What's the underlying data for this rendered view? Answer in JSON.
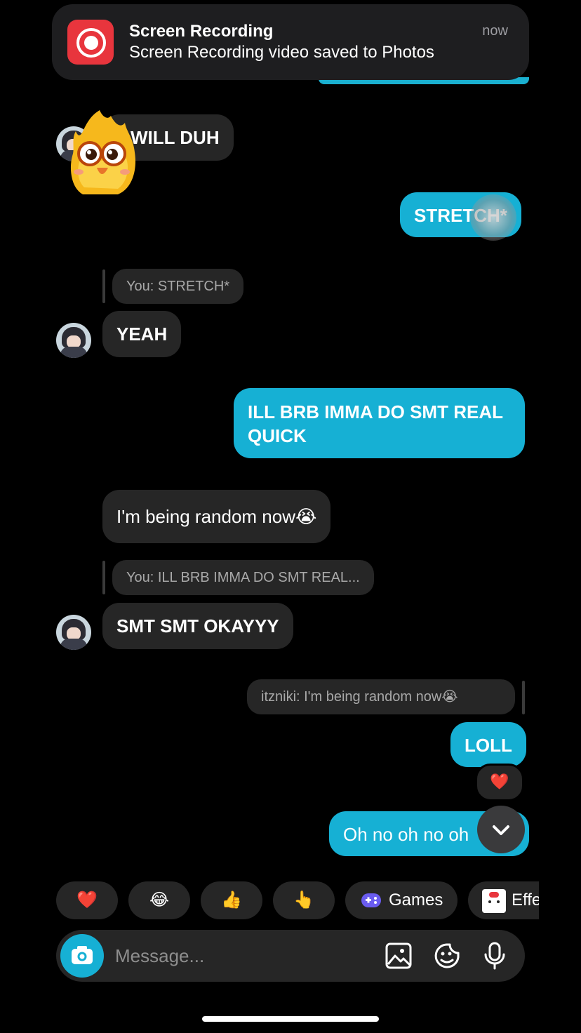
{
  "notification": {
    "title": "Screen Recording",
    "body": "Screen Recording video saved to Photos",
    "time": "now",
    "icon": "screen-recording-icon",
    "accent": "#e8353d"
  },
  "messages": {
    "m1": "WILL DUH",
    "m2": "STRETCH*",
    "reply1": "You: STRETCH*",
    "m3": "YEAH",
    "m4": "ILL BRB IMMA DO SMT REAL QUICK",
    "m5": "I'm being random now😭",
    "reply2": "You: ILL BRB IMMA DO SMT REAL...",
    "m6": "SMT SMT OKAYYY",
    "reply3": "itzniki: I'm being random now😭",
    "m7": "LOLL",
    "m7_reaction": "❤️",
    "m8": "Oh no oh no oh"
  },
  "quick_reactions": {
    "r1": "❤️",
    "r2": "😂",
    "r3": "👍",
    "r4": "👆",
    "games": "Games",
    "effects": "Effe"
  },
  "composer": {
    "placeholder": "Message..."
  },
  "colors": {
    "outgoing_bubble": "#16b0d4",
    "incoming_bubble": "#262626",
    "background": "#000000"
  }
}
